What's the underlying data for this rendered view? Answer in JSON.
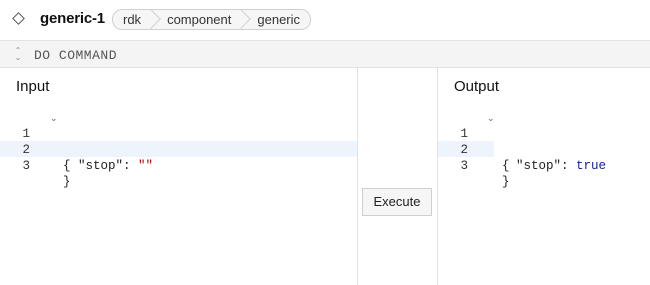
{
  "header": {
    "title": "generic-1",
    "icon": "diamond-icon",
    "breadcrumbs": [
      "rdk",
      "component",
      "generic"
    ]
  },
  "command_bar": {
    "label": "DO COMMAND",
    "icon": "collapse-icon"
  },
  "input": {
    "title": "Input",
    "lines": [
      {
        "num": "1",
        "text": "{"
      },
      {
        "num": "2",
        "key": "\"stop\"",
        "sep": ": ",
        "value": "\"\""
      },
      {
        "num": "3",
        "text": "}"
      }
    ]
  },
  "output": {
    "title": "Output",
    "lines": [
      {
        "num": "1",
        "text": "{"
      },
      {
        "num": "2",
        "key": "\"stop\"",
        "sep": ": ",
        "value": "true"
      },
      {
        "num": "3",
        "text": "}"
      }
    ]
  },
  "execute_label": "Execute",
  "colors": {
    "string_value": "#a31515",
    "keyword_value": "#1a1aa6",
    "active_line": "#eef4fb"
  }
}
